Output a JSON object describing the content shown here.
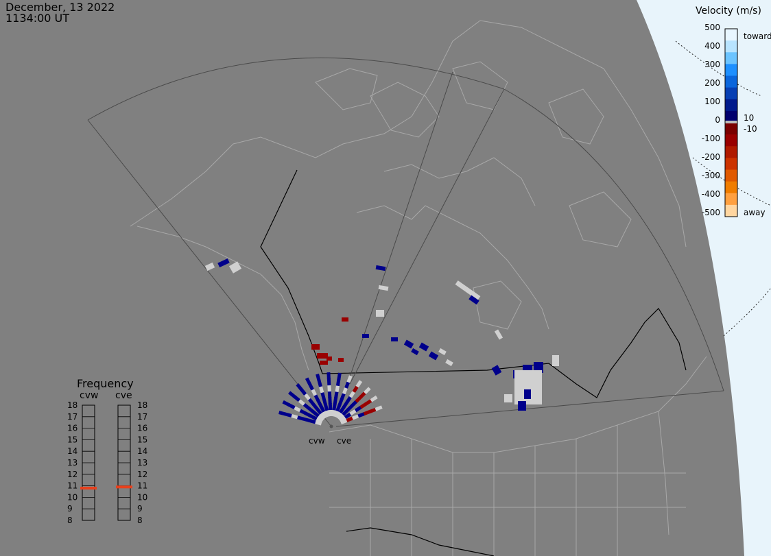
{
  "header": {
    "date": "December, 13 2022",
    "time": "1134:00 UT"
  },
  "colors": {
    "background": "#808080",
    "ocean": "#e8f4fb",
    "land_edge": "#a8a8a8",
    "fov": "#4a4a4a",
    "border": "#000000",
    "ground_scatter": "#d0d0d0",
    "freq_marker": "#e8401c"
  },
  "velocity_scale": {
    "title": "Velocity (m/s)",
    "ticks": [
      "500",
      "400",
      "300",
      "200",
      "100",
      "0",
      "-100",
      "-200",
      "-300",
      "-400",
      "-500"
    ],
    "inner_labels": [
      "10",
      "-10"
    ],
    "toward_label": "toward",
    "away_label": "away",
    "colors": [
      "#e8f6ff",
      "#b8e4ff",
      "#6cc4ff",
      "#1e90ff",
      "#0a66dc",
      "#063fb4",
      "#001a8c",
      "#00006e",
      "#7a0000",
      "#990000",
      "#b01a00",
      "#cc3300",
      "#e05a00",
      "#f07d00",
      "#ffa040",
      "#ffd6a0"
    ]
  },
  "radars": {
    "labels": [
      "cvw",
      "cve"
    ]
  },
  "frequency": {
    "title": "Frequency",
    "radars": [
      "cvw",
      "cve"
    ],
    "ticks": [
      "18",
      "17",
      "16",
      "15",
      "14",
      "13",
      "12",
      "11",
      "10",
      "9",
      "8"
    ],
    "cvw_mhz": 10.8,
    "cve_mhz": 10.9
  }
}
